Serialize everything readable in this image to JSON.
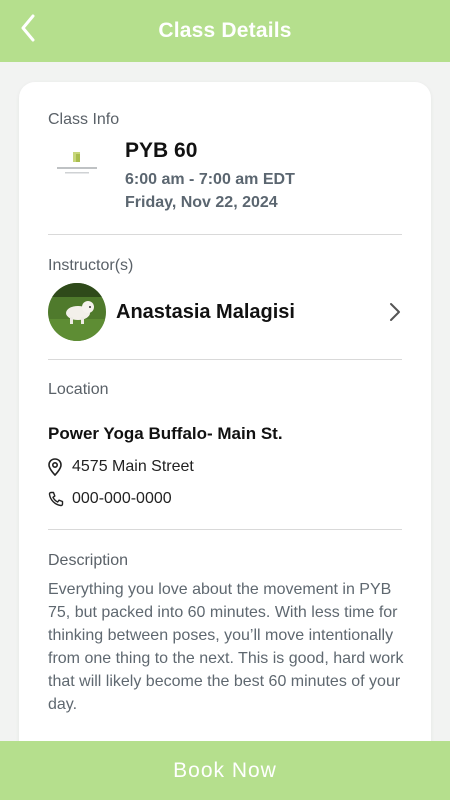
{
  "header": {
    "title": "Class Details",
    "back_icon": "chevron-left-icon"
  },
  "class_info": {
    "section_label": "Class Info",
    "name": "PYB 60",
    "time": "6:00 am - 7:00 am EDT",
    "date": "Friday, Nov 22, 2024",
    "logo_icon": "power-yoga-logo"
  },
  "instructor": {
    "section_label": "Instructor(s)",
    "name": "Anastasia Malagisi",
    "chevron_icon": "chevron-right-icon"
  },
  "location": {
    "section_label": "Location",
    "name": "Power Yoga Buffalo- Main St.",
    "address": "4575 Main Street",
    "phone": "000-000-0000",
    "address_icon": "map-pin-icon",
    "phone_icon": "phone-icon"
  },
  "description": {
    "section_label": "Description",
    "text": "Everything you love about the movement in PYB 75, but packed into 60 minutes. With less time for thinking between poses, you’ll move intentionally from one thing to the next. This is good, hard work that will likely become the best 60 minutes of your day."
  },
  "footer": {
    "book_label": "Book Now"
  },
  "colors": {
    "accent": "#b5df8d",
    "muted_text": "#5b6670"
  }
}
